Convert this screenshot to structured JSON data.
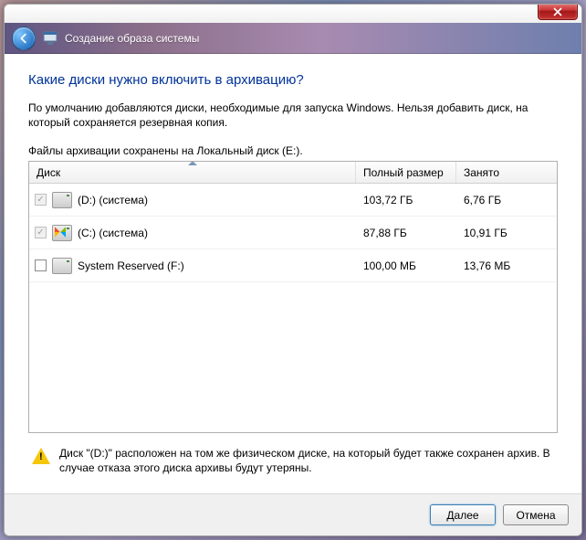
{
  "window": {
    "title": "Создание образа системы"
  },
  "page": {
    "heading": "Какие диски нужно включить в архивацию?",
    "description": "По умолчанию добавляются диски, необходимые для запуска Windows. Нельзя добавить диск, на который сохраняется резервная копия.",
    "saved_on": "Файлы архивации сохранены на Локальный диск (E:)."
  },
  "table": {
    "headers": {
      "disk": "Диск",
      "size": "Полный размер",
      "used": "Занято"
    },
    "rows": [
      {
        "checked": true,
        "disabled": true,
        "icon": "drive",
        "label": "(D:) (система)",
        "size": "103,72 ГБ",
        "used": "6,76 ГБ"
      },
      {
        "checked": true,
        "disabled": true,
        "icon": "win",
        "label": "(C:) (система)",
        "size": "87,88 ГБ",
        "used": "10,91 ГБ"
      },
      {
        "checked": false,
        "disabled": false,
        "icon": "drive",
        "label": "System Reserved (F:)",
        "size": "100,00 МБ",
        "used": "13,76 МБ"
      }
    ]
  },
  "warning": {
    "text": "Диск \"(D:)\" расположен на том же физическом диске, на который будет также сохранен архив. В случае отказа этого диска архивы будут утеряны."
  },
  "buttons": {
    "next": "Далее",
    "cancel": "Отмена"
  }
}
